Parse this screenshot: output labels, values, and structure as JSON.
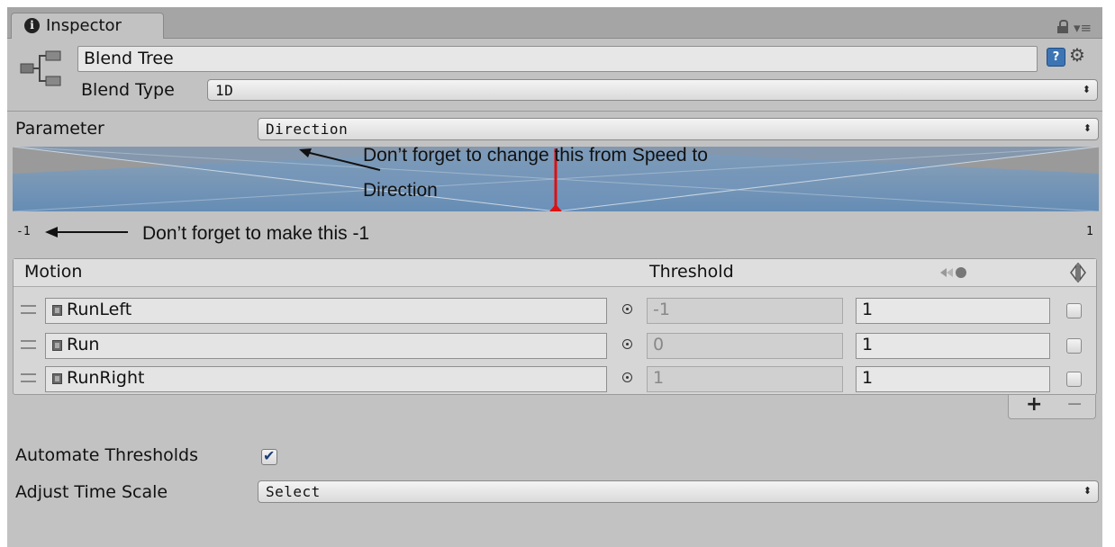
{
  "tab": {
    "label": "Inspector"
  },
  "header": {
    "name": "Blend Tree",
    "blend_type_label": "Blend Type",
    "blend_type_value": "1D"
  },
  "parameter": {
    "label": "Parameter",
    "value": "Direction"
  },
  "annotations": {
    "parameter_line1": "Don’t forget to change this from Speed to",
    "parameter_line2": "Direction",
    "min": "Don’t forget to make this -1"
  },
  "range": {
    "min": "-1",
    "max": "1"
  },
  "table": {
    "motion_header": "Motion",
    "threshold_header": "Threshold",
    "rows": [
      {
        "motion": "RunLeft",
        "threshold": "-1",
        "speed": "1"
      },
      {
        "motion": "Run",
        "threshold": "0",
        "speed": "1"
      },
      {
        "motion": "RunRight",
        "threshold": "1",
        "speed": "1"
      }
    ]
  },
  "buttons": {
    "add": "+",
    "remove": "−"
  },
  "automate": {
    "label": "Automate Thresholds",
    "checked": true
  },
  "time_scale": {
    "label": "Adjust Time Scale",
    "value": "Select"
  },
  "colors": {
    "accent_blue": "#3c74b4",
    "graph_blue": "#6c93b8",
    "marker_red": "#d11"
  }
}
